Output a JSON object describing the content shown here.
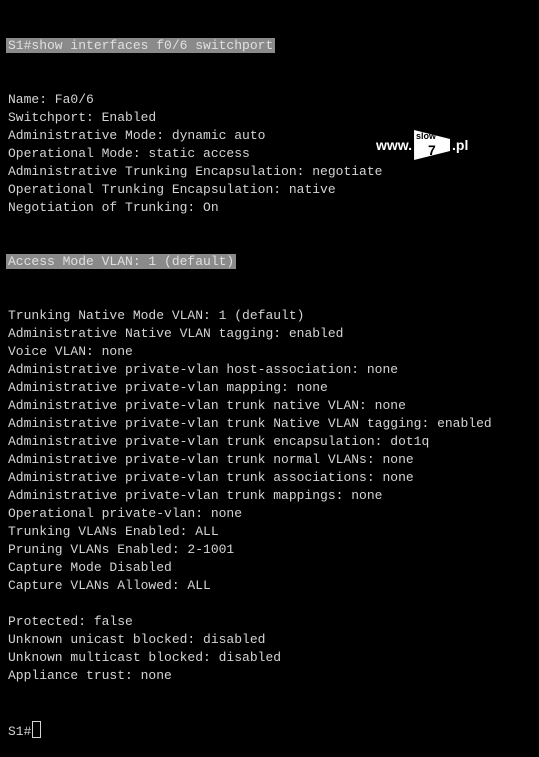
{
  "terminal": {
    "command_line": "S1#show interfaces f0/6 switchport",
    "lines": [
      "Name: Fa0/6",
      "Switchport: Enabled",
      "Administrative Mode: dynamic auto",
      "Operational Mode: static access",
      "Administrative Trunking Encapsulation: negotiate",
      "Operational Trunking Encapsulation: native",
      "Negotiation of Trunking: On"
    ],
    "highlighted_line": "Access Mode VLAN: 1 (default)",
    "lines2": [
      "Trunking Native Mode VLAN: 1 (default)",
      "Administrative Native VLAN tagging: enabled",
      "Voice VLAN: none",
      "Administrative private-vlan host-association: none",
      "Administrative private-vlan mapping: none",
      "Administrative private-vlan trunk native VLAN: none",
      "Administrative private-vlan trunk Native VLAN tagging: enabled",
      "Administrative private-vlan trunk encapsulation: dot1q",
      "Administrative private-vlan trunk normal VLANs: none",
      "Administrative private-vlan trunk associations: none",
      "Administrative private-vlan trunk mappings: none",
      "Operational private-vlan: none",
      "Trunking VLANs Enabled: ALL",
      "Pruning VLANs Enabled: 2-1001",
      "Capture Mode Disabled",
      "Capture VLANs Allowed: ALL",
      "",
      "Protected: false",
      "Unknown unicast blocked: disabled",
      "Unknown multicast blocked: disabled",
      "Appliance trust: none"
    ],
    "prompt": "S1#"
  },
  "watermark": {
    "prefix": "www.",
    "box_top": "slow",
    "box_num": "7",
    "suffix": ".pl"
  }
}
